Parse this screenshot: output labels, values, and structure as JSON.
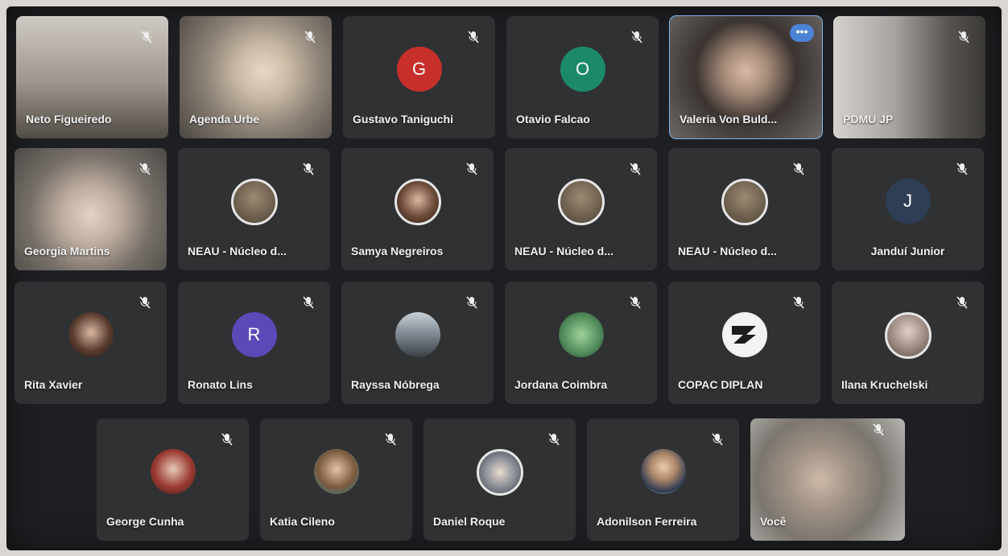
{
  "participants_row1": [
    {
      "name": "Neto Figueiredo",
      "type": "video"
    },
    {
      "name": "Agenda Urbe",
      "type": "video"
    },
    {
      "name": "Gustavo Taniguchi",
      "type": "letter",
      "initial": "G",
      "color": "#c62f2a"
    },
    {
      "name": "Otavio Falcao",
      "type": "letter",
      "initial": "O",
      "color": "#1c8a68"
    },
    {
      "name": "Valeria Von Buld...",
      "type": "video",
      "pinned": true
    },
    {
      "name": "PDMU JP",
      "type": "video"
    }
  ],
  "participants_row2": [
    {
      "name": "Georgia Martins",
      "type": "video"
    },
    {
      "name": "NEAU - Núcleo d...",
      "type": "photo",
      "photo_color": "#6b5a45"
    },
    {
      "name": "Samya Negreiros",
      "type": "photo",
      "photo_color": "#4a3426"
    },
    {
      "name": "NEAU - Núcleo d...",
      "type": "photo",
      "photo_color": "#6b5a45"
    },
    {
      "name": "NEAU - Núcleo d...",
      "type": "photo",
      "photo_color": "#6b5a45"
    },
    {
      "name": "Janduí Junior",
      "type": "letter",
      "initial": "J",
      "color": "#2d3e55"
    }
  ],
  "participants_row3": [
    {
      "name": "Rita Xavier",
      "type": "photo",
      "photo_color": "#3a2a24"
    },
    {
      "name": "Ronato Lins",
      "type": "letter",
      "initial": "R",
      "color": "#5b49b8"
    },
    {
      "name": "Rayssa Nóbrega",
      "type": "photo",
      "photo_color": "#546470"
    },
    {
      "name": "Jordana Coimbra",
      "type": "photo",
      "photo_color": "#4f8a5a"
    },
    {
      "name": "COPAC DIPLAN",
      "type": "photo",
      "photo_color": "#f3f3f3"
    },
    {
      "name": "Ilana Kruchelski",
      "type": "photo",
      "photo_color": "#a08f84"
    }
  ],
  "participants_row4": [
    {
      "name": "George Cunha",
      "type": "photo",
      "photo_color": "#9a3a32"
    },
    {
      "name": "Katia Cileno",
      "type": "photo",
      "photo_color": "#7a5a3d"
    },
    {
      "name": "Daniel Roque",
      "type": "photo",
      "photo_color": "#3a4250"
    },
    {
      "name": "Adonilson Ferreira",
      "type": "photo",
      "photo_color": "#2e3b52"
    },
    {
      "name": "Você",
      "type": "video",
      "self": true
    }
  ],
  "icons": {
    "mic_off": "mic-off-icon",
    "more": "more-options-icon"
  },
  "more_label": "•••"
}
